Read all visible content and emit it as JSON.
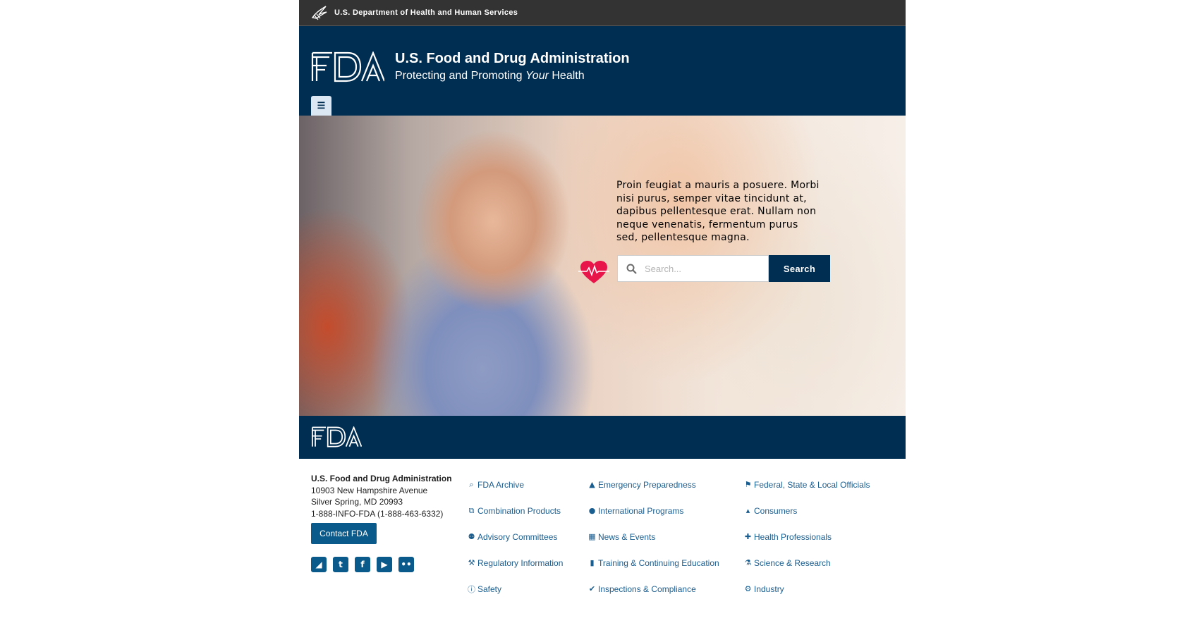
{
  "hhs": {
    "label": "U.S. Department of Health and Human Services"
  },
  "header": {
    "logo_text": "FDA",
    "title": "U.S. Food and Drug Administration",
    "tagline_pre": "Protecting and Promoting ",
    "tagline_em": "Your",
    "tagline_post": " Health",
    "menu_icon": "menu-icon"
  },
  "hero": {
    "text": "Proin feugiat a mauris a posuere. Morbi nisi purus, semper vitae tincidunt at, dapibus pellentesque erat. Nullam non neque venenatis, fermentum purus sed, pellentesque magna.",
    "search_placeholder": "Search...",
    "search_button": "Search",
    "heart_color": "#e8154b"
  },
  "footer": {
    "logo_text": "FDA",
    "org_name": "U.S. Food and Drug Administration",
    "address1": "10903 New Hampshire Avenue",
    "address2": "Silver Spring, MD 20993",
    "phone": "1-888-INFO-FDA (1-888-463-6332)",
    "contact_button": "Contact FDA",
    "social": [
      {
        "name": "rss-icon",
        "glyph": "◢"
      },
      {
        "name": "twitter-icon",
        "glyph": "t"
      },
      {
        "name": "facebook-icon",
        "glyph": "f"
      },
      {
        "name": "youtube-icon",
        "glyph": "▶"
      },
      {
        "name": "flickr-icon",
        "glyph": "••"
      }
    ],
    "links_col1": [
      {
        "label": "FDA Archive",
        "icon": "⌕"
      },
      {
        "label": "Combination Products",
        "icon": "⧉"
      },
      {
        "label": "Advisory Committees",
        "icon": "⚉"
      },
      {
        "label": "Regulatory Information",
        "icon": "⚒"
      },
      {
        "label": "Safety",
        "icon": "ⓘ"
      }
    ],
    "links_col2": [
      {
        "label": "Emergency Preparedness",
        "icon": "▲"
      },
      {
        "label": "International Programs",
        "icon": "●"
      },
      {
        "label": "News & Events",
        "icon": "▦"
      },
      {
        "label": "Training & Continuing Education",
        "icon": "▮"
      },
      {
        "label": "Inspections & Compliance",
        "icon": "✔"
      }
    ],
    "links_col3": [
      {
        "label": "Federal, State & Local Officials",
        "icon": "⚑"
      },
      {
        "label": "Consumers",
        "icon": "▴"
      },
      {
        "label": "Health Professionals",
        "icon": "✚"
      },
      {
        "label": "Science & Research",
        "icon": "⚗"
      },
      {
        "label": "Industry",
        "icon": "⚙"
      }
    ],
    "link_color": "#1a5d8f"
  },
  "colors": {
    "navy": "#002e52",
    "hhs_bar": "#333333",
    "button_blue": "#0a5a8c"
  }
}
